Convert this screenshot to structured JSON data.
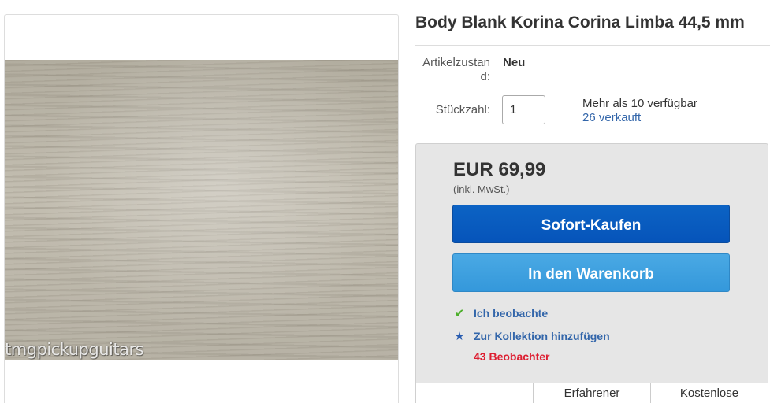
{
  "listing": {
    "title": "Body Blank Korina Corina Limba 44,5 mm",
    "image_watermark": "tmgpickupguitars"
  },
  "details": {
    "condition_label": "Artikelzustan d:",
    "condition_value": "Neu",
    "quantity_label": "Stückzahl:",
    "quantity_value": "1",
    "availability": "Mehr als 10 verfügbar",
    "sold": "26 verkauft"
  },
  "buy_box": {
    "price": "EUR 69,99",
    "tax_note": "(inkl. MwSt.)",
    "buy_now_label": "Sofort-Kaufen",
    "add_to_cart_label": "In den Warenkorb",
    "watch_label": "Ich beobachte",
    "add_to_collection_label": "Zur Kollektion hinzufügen",
    "watchers": "43 Beobachter",
    "colors": {
      "buy_now": "#0654ba",
      "add_to_cart": "#3498db",
      "watchers": "#dd1e31",
      "link": "#3366aa",
      "check": "#4caf2a"
    }
  },
  "info_table": {
    "cells": [
      "",
      "Erfahrener",
      "Kostenlose"
    ]
  },
  "icons": {
    "watch": "checkmark-icon",
    "collection": "star-icon"
  }
}
